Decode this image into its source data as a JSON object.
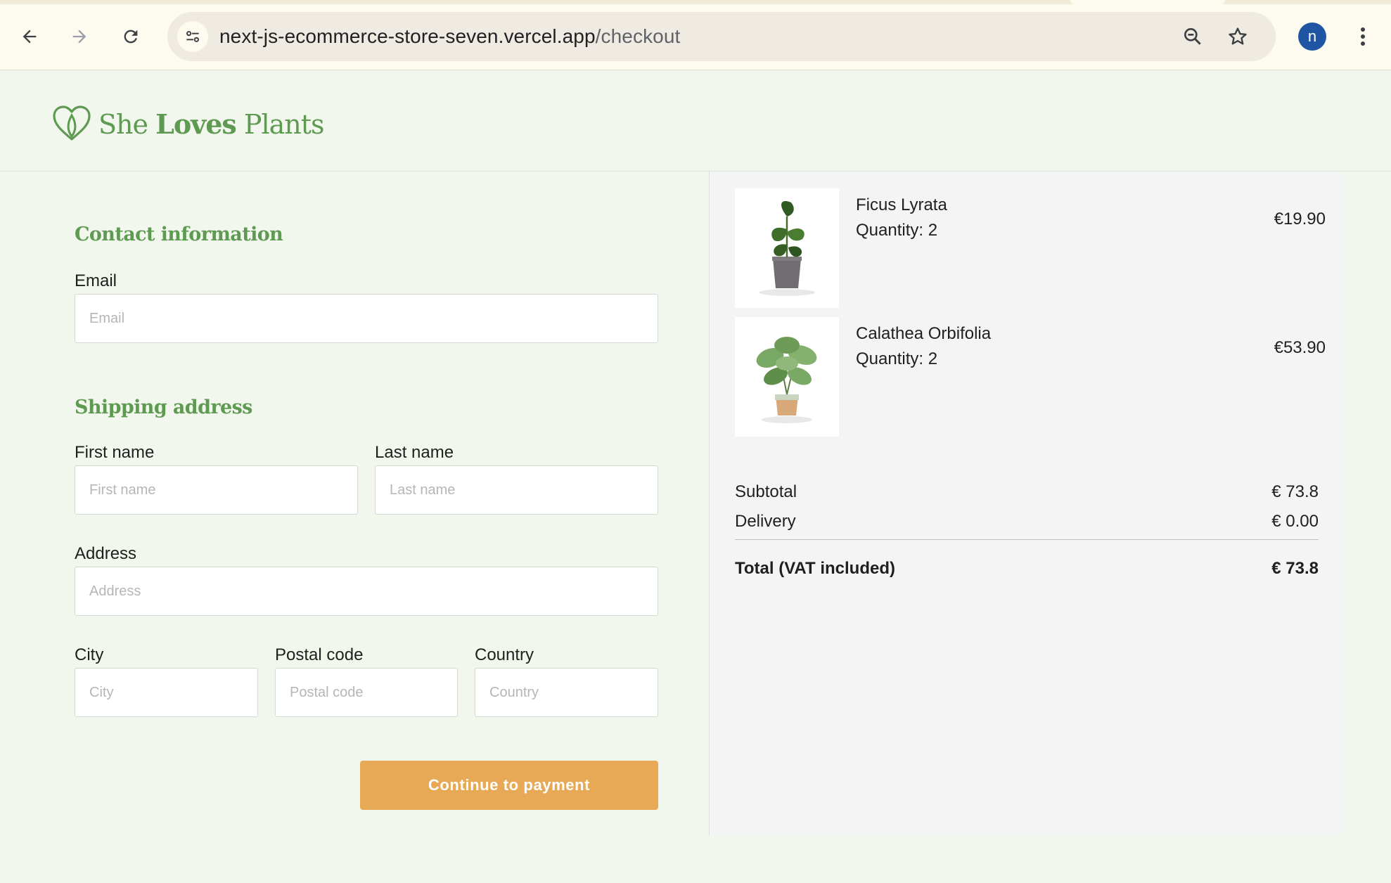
{
  "browser": {
    "url_host": "next-js-ecommerce-store-seven.vercel.app",
    "url_path": "/checkout",
    "avatar_letter": "n",
    "icons": [
      "back-arrow-icon",
      "forward-arrow-icon",
      "reload-icon",
      "site-settings-icon",
      "zoom-icon",
      "bookmark-star-icon",
      "kebab-menu-icon"
    ]
  },
  "brand": {
    "name_part1": "She",
    "name_part2": "Loves",
    "name_part3": "Plants",
    "color": "#5f9a52"
  },
  "contact": {
    "title": "Contact information",
    "email_label": "Email",
    "email_placeholder": "Email",
    "email_value": ""
  },
  "shipping": {
    "title": "Shipping address",
    "first_name_label": "First name",
    "first_name_placeholder": "First name",
    "last_name_label": "Last name",
    "last_name_placeholder": "Last name",
    "address_label": "Address",
    "address_placeholder": "Address",
    "city_label": "City",
    "city_placeholder": "City",
    "postal_label": "Postal code",
    "postal_placeholder": "Postal code",
    "country_label": "Country",
    "country_placeholder": "Country"
  },
  "actions": {
    "continue_label": "Continue to payment",
    "continue_color": "#e7a955"
  },
  "cart": {
    "items": [
      {
        "name": "Ficus Lyrata",
        "quantity": "Quantity: 2",
        "price": "€19.90"
      },
      {
        "name": "Calathea Orbifolia",
        "quantity": "Quantity: 2",
        "price": "€53.90"
      }
    ],
    "subtotal_label": "Subtotal",
    "subtotal_value": "€ 73.8",
    "delivery_label": "Delivery",
    "delivery_value": "€ 0.00",
    "total_label": "Total (VAT included)",
    "total_value": "€ 73.8"
  }
}
